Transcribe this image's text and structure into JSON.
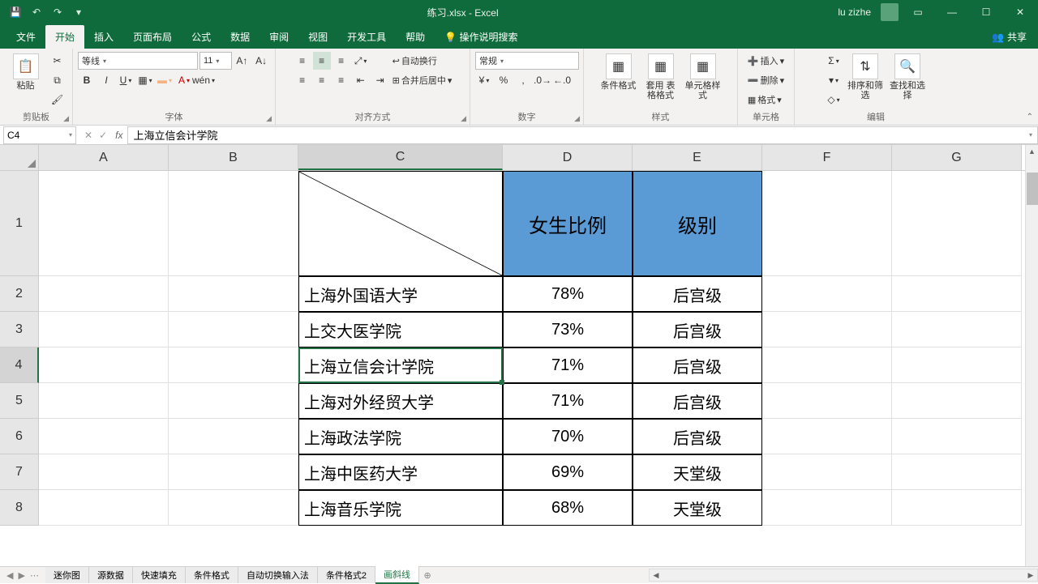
{
  "title": "练习.xlsx  -  Excel",
  "user": "lu zizhe",
  "tabs": [
    "文件",
    "开始",
    "插入",
    "页面布局",
    "公式",
    "数据",
    "审阅",
    "视图",
    "开发工具",
    "帮助"
  ],
  "tell_me": "操作说明搜索",
  "share": "共享",
  "ribbon": {
    "clipboard": {
      "paste": "粘贴",
      "label": "剪贴板"
    },
    "font": {
      "name": "等线",
      "size": "11",
      "label": "字体"
    },
    "align": {
      "wrap": "自动换行",
      "merge": "合并后居中",
      "label": "对齐方式"
    },
    "number": {
      "format": "常规",
      "label": "数字"
    },
    "styles": {
      "cond": "条件格式",
      "table": "套用\n表格格式",
      "cell": "单元格样式",
      "label": "样式"
    },
    "cells": {
      "insert": "插入",
      "delete": "删除",
      "format": "格式",
      "label": "单元格"
    },
    "editing": {
      "sort": "排序和筛选",
      "find": "查找和选择",
      "label": "编辑"
    }
  },
  "namebox": "C4",
  "formula": "上海立信会计学院",
  "headers": {
    "C": "",
    "D": "女生比例",
    "E": "级别"
  },
  "rows": [
    {
      "c": "上海外国语大学",
      "d": "78%",
      "e": "后宫级"
    },
    {
      "c": "上交大医学院",
      "d": "73%",
      "e": "后宫级"
    },
    {
      "c": "上海立信会计学院",
      "d": "71%",
      "e": "后宫级"
    },
    {
      "c": "上海对外经贸大学",
      "d": "71%",
      "e": "后宫级"
    },
    {
      "c": "上海政法学院",
      "d": "70%",
      "e": "后宫级"
    },
    {
      "c": "上海中医药大学",
      "d": "69%",
      "e": "天堂级"
    },
    {
      "c": "上海音乐学院",
      "d": "68%",
      "e": "天堂级"
    }
  ],
  "sheet_tabs": [
    "迷你图",
    "源数据",
    "快速填充",
    "条件格式",
    "自动切换输入法",
    "条件格式2",
    "画斜线"
  ],
  "active_sheet": 6
}
